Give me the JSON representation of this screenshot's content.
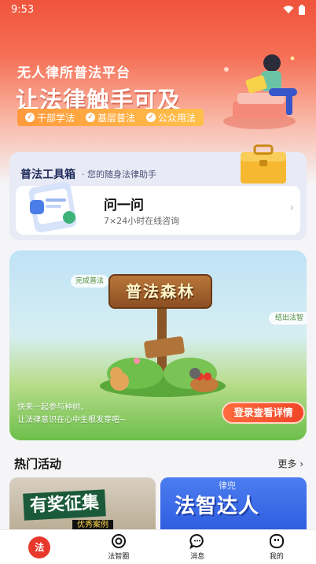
{
  "status": {
    "time": "9:53"
  },
  "hero": {
    "subtitle": "无人律所普法平台",
    "title": "让法律触手可及",
    "tags": [
      "干部学法",
      "基层普法",
      "公众用法"
    ]
  },
  "toolbox": {
    "title": "普法工具箱",
    "subtitle": "· 您的随身法律助手",
    "ask": {
      "title": "问一问",
      "subtitle": "7×24小时在线咨询"
    }
  },
  "forest": {
    "sign": "普法森林",
    "bubble_left": "完成普法",
    "bubble_right": "结出法智",
    "desc_line1": "快来一起参与种树，",
    "desc_line2": "让法律意识在心中生根发芽吧~",
    "button": "登录查看详情"
  },
  "activities": {
    "title": "热门活动",
    "more": "更多",
    "cards": [
      {
        "title": "有奖征集",
        "sub": "优秀案例"
      },
      {
        "title": "法智达人",
        "logo": "律兜"
      }
    ]
  },
  "nav": {
    "items": [
      {
        "label": "",
        "icon": "home-logo"
      },
      {
        "label": "法智圈",
        "icon": "circle-icon"
      },
      {
        "label": "消息",
        "icon": "chat-icon"
      },
      {
        "label": "我的",
        "icon": "profile-icon"
      }
    ]
  },
  "colors": {
    "accent": "#e8382c",
    "button": "#f04628",
    "toolbox_bg": "#e8ebf5"
  }
}
